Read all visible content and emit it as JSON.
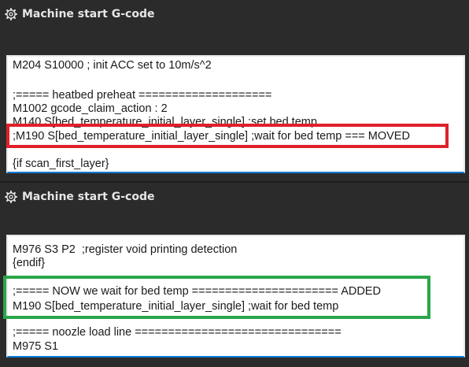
{
  "top_panel": {
    "title": "Machine start G-code",
    "lines": [
      "M204 S10000 ; init ACC set to 10m/s^2",
      "",
      ";===== heatbed preheat ====================",
      "M1002 gcode_claim_action : 2",
      "M140 S[bed_temperature_initial_layer_single] ;set bed temp",
      ";M190 S[bed_temperature_initial_layer_single] ;wait for bed temp === MOVED",
      "",
      "{if scan_first_layer}"
    ]
  },
  "bottom_panel": {
    "title": "Machine start G-code",
    "lines": [
      "M976 S3 P2  ;register void printing detection",
      "{endif}",
      "",
      ";===== NOW we wait for bed temp ====================== ADDED",
      "M190 S[bed_temperature_initial_layer_single] ;wait for bed temp",
      "",
      ";===== noozle load line ===============================",
      "M975 S1"
    ]
  },
  "colors": {
    "background": "#2b2b2b",
    "editor_bg": "#ffffff",
    "focus_underline": "#0a7ad6",
    "highlight_moved": "#e0202a",
    "highlight_added": "#2aa64a"
  },
  "icons": {
    "header_icon": "gear-icon"
  }
}
